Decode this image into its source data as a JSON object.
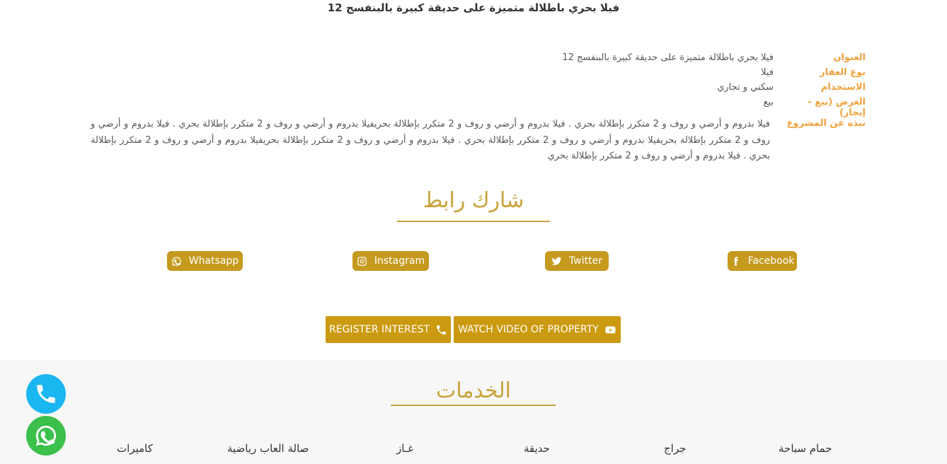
{
  "page": {
    "title": "فيلا بحري باطلالة متميزة على حديقة كبيرة بالبنفسج 12"
  },
  "details": {
    "address_label": "العنوان",
    "address_value": "فيلا بحري باطلالة متميزة على حديقة كبيرة بالبنفسج 12",
    "type_label": "نوع العقار",
    "type_value": "فيلا",
    "usage_label": "الاستخدام",
    "usage_value": "سكني و تجاري",
    "purpose_label": "الغرض (بيع - إيجار)",
    "purpose_value": "بيع",
    "about_label": "نبذه عن المشروع",
    "about_value": "فيلا بدروم و أرضي و روف و 2 متكرر بإطلالة بحري . فيلا بدروم و أرضي و روف و 2 متكرر بإطلالة بحريفيلا بدروم و أرضي و روف و 2 متكرر بإطلالة بحري . فيلا بدروم و أرضي و روف و 2 متكرر بإطلالة بحريفيلا بدروم و أرضي و روف و 2 متكرر بإطلالة بحري . فيلا بدروم و أرضي و روف و 2 متكرر بإطلالة بحريفيلا بدروم و أرضي و روف و 2 متكرر بإطلالة بحري . فيلا بدروم و أرضي و روف و 2 متكرر بإطلالة بحري"
  },
  "share": {
    "heading": "شارك رابط",
    "facebook": "Facebook",
    "twitter": "Twitter",
    "instagram": "Instagram",
    "whatsapp": "Whatsapp"
  },
  "actions": {
    "register_interest": "REGISTER INTEREST",
    "watch_video": "WATCH VIDEO OF PROPERTY"
  },
  "services": {
    "heading": "الخدمات",
    "items": [
      "حمام سباحة",
      "جراج",
      "حديقة",
      "غـاز",
      "صالة العاب رياضية",
      "كاميرات"
    ]
  },
  "colors": {
    "gold": "#c9a33a",
    "button_gold": "#cc9a10",
    "label_orange": "#f0a23c",
    "call_blue": "#1ab6f0",
    "whatsapp_green": "#3ac04b",
    "services_bg": "#f7f7f7"
  },
  "icons": {
    "facebook": "facebook-icon",
    "twitter": "twitter-icon",
    "instagram": "instagram-icon",
    "whatsapp": "whatsapp-icon",
    "phone": "phone-icon",
    "youtube": "youtube-icon"
  }
}
